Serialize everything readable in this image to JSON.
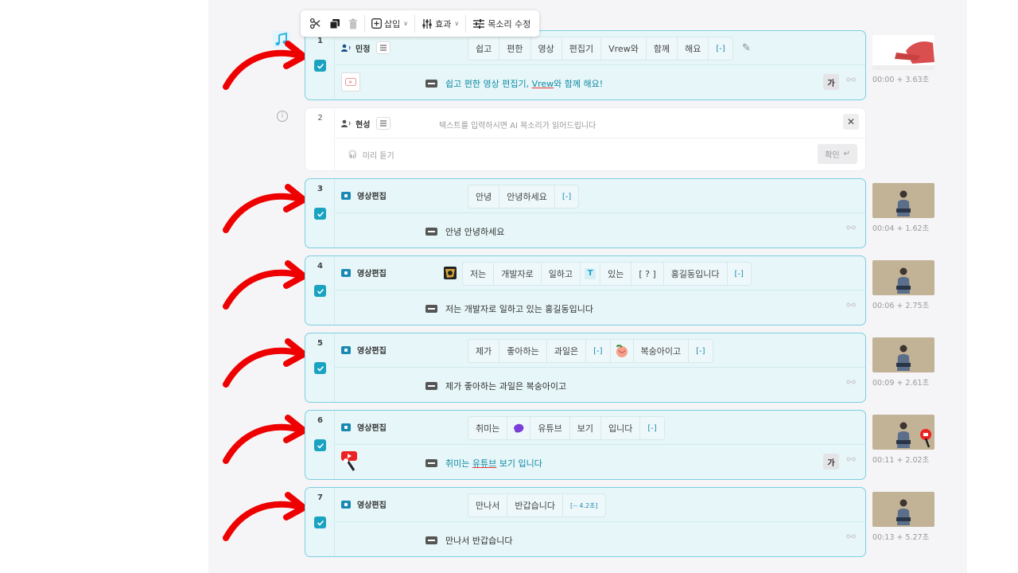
{
  "toolbar": {
    "insert_label": "삽입",
    "effect_label": "효과",
    "voice_edit_label": "목소리 수정"
  },
  "clips": [
    {
      "index": "1",
      "speaker": "민정",
      "speaker_type": "voice",
      "words": [
        "쉽고",
        "편한",
        "영상",
        "편집기",
        "Vrew와",
        "함께",
        "해요",
        "[-]"
      ],
      "subtitle": "쉽고 편한 영상 편집기, Vrew와 함께 해요!",
      "subtitle_underlined": "Vrew",
      "ga_label": "가",
      "time": "00:00 + 3.63초"
    },
    {
      "index": "3",
      "speaker": "영상편집",
      "words": [
        "안녕",
        "안녕하세요",
        "[-]"
      ],
      "subtitle": "안녕 안녕하세요",
      "time": "00:04 + 1.62초"
    },
    {
      "index": "4",
      "speaker": "영상편집",
      "words": [
        "저는",
        "개발자로",
        "일하고",
        "있는",
        "[ ? ]",
        "홍길동입니다",
        "[-]"
      ],
      "subtitle": "저는 개발자로 일하고 있는 홍길동입니다",
      "time": "00:06 + 2.75초"
    },
    {
      "index": "5",
      "speaker": "영상편집",
      "words": [
        "제가",
        "좋아하는",
        "과일은",
        "[-]",
        "복숭아이고",
        "[-]"
      ],
      "subtitle": "제가 좋아하는 과일은 복숭아이고",
      "time": "00:09 + 2.61초"
    },
    {
      "index": "6",
      "speaker": "영상편집",
      "words": [
        "취미는",
        "유튜브",
        "보기",
        "입니다",
        "[-]"
      ],
      "subtitle_a": "취미는 ",
      "subtitle_u": "유튜브",
      "subtitle_b": " 보기 입니다",
      "ga_label": "가",
      "time": "00:11 + 2.02초"
    },
    {
      "index": "7",
      "speaker": "영상편집",
      "words": [
        "만나서",
        "반갑습니다",
        "[-- 4.2초]"
      ],
      "subtitle": "만나서 반갑습니다",
      "time": "00:13 + 5.27초"
    }
  ],
  "input_clip": {
    "index": "2",
    "speaker": "현성",
    "placeholder": "텍스트를 입력하시면 AI 목소리가 읽어드립니다",
    "preview_label": "미리 듣기",
    "confirm_label": "확인"
  },
  "colors": {
    "accent": "#1aa3c0",
    "clip_bg": "#e7f6f8",
    "clip_border": "#7dcfe0",
    "arrow": "#ee0000"
  }
}
